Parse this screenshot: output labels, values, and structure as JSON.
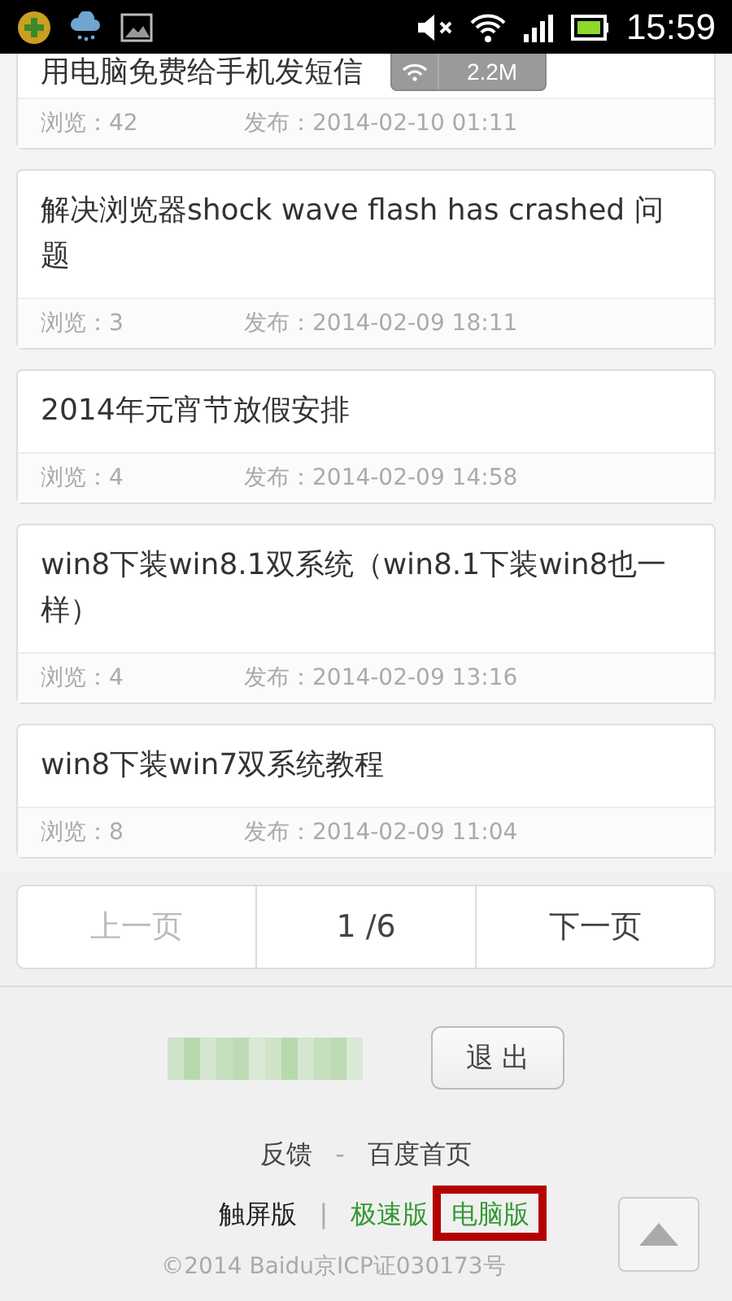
{
  "status_bar": {
    "time": "15:59"
  },
  "toast": {
    "text": "2.2M"
  },
  "posts": [
    {
      "title": "用电脑免费给手机发短信",
      "views_label": "浏览：42",
      "published_label": "发布：2014-02-10 01:11",
      "cut": true
    },
    {
      "title": "解决浏览器shock wave flash has crashed 问题",
      "views_label": "浏览：3",
      "published_label": "发布：2014-02-09 18:11",
      "cut": false
    },
    {
      "title": "2014年元宵节放假安排",
      "views_label": "浏览：4",
      "published_label": "发布：2014-02-09 14:58",
      "cut": false
    },
    {
      "title": "win8下装win8.1双系统（win8.1下装win8也一样）",
      "views_label": "浏览：4",
      "published_label": "发布：2014-02-09 13:16",
      "cut": false
    },
    {
      "title": "win8下装win7双系统教程",
      "views_label": "浏览：8",
      "published_label": "发布：2014-02-09 11:04",
      "cut": false
    }
  ],
  "pager": {
    "prev": {
      "label": "上一页",
      "disabled": true
    },
    "page": "1 /6",
    "next": {
      "label": "下一页",
      "disabled": false
    }
  },
  "account": {
    "logout": "退 出"
  },
  "footer_links": [
    {
      "label": "反馈",
      "kind": "link"
    },
    {
      "label": "-",
      "kind": "separator"
    },
    {
      "label": "百度首页",
      "kind": "link"
    }
  ],
  "versions": [
    {
      "label": "触屏版",
      "selected": true,
      "highlighted": false
    },
    {
      "label": "极速版",
      "selected": false,
      "highlighted": false
    },
    {
      "label": "电脑版",
      "selected": false,
      "highlighted": true
    }
  ],
  "version_separator": "|",
  "copyright": "©2014 Baidu京ICP证030173号"
}
